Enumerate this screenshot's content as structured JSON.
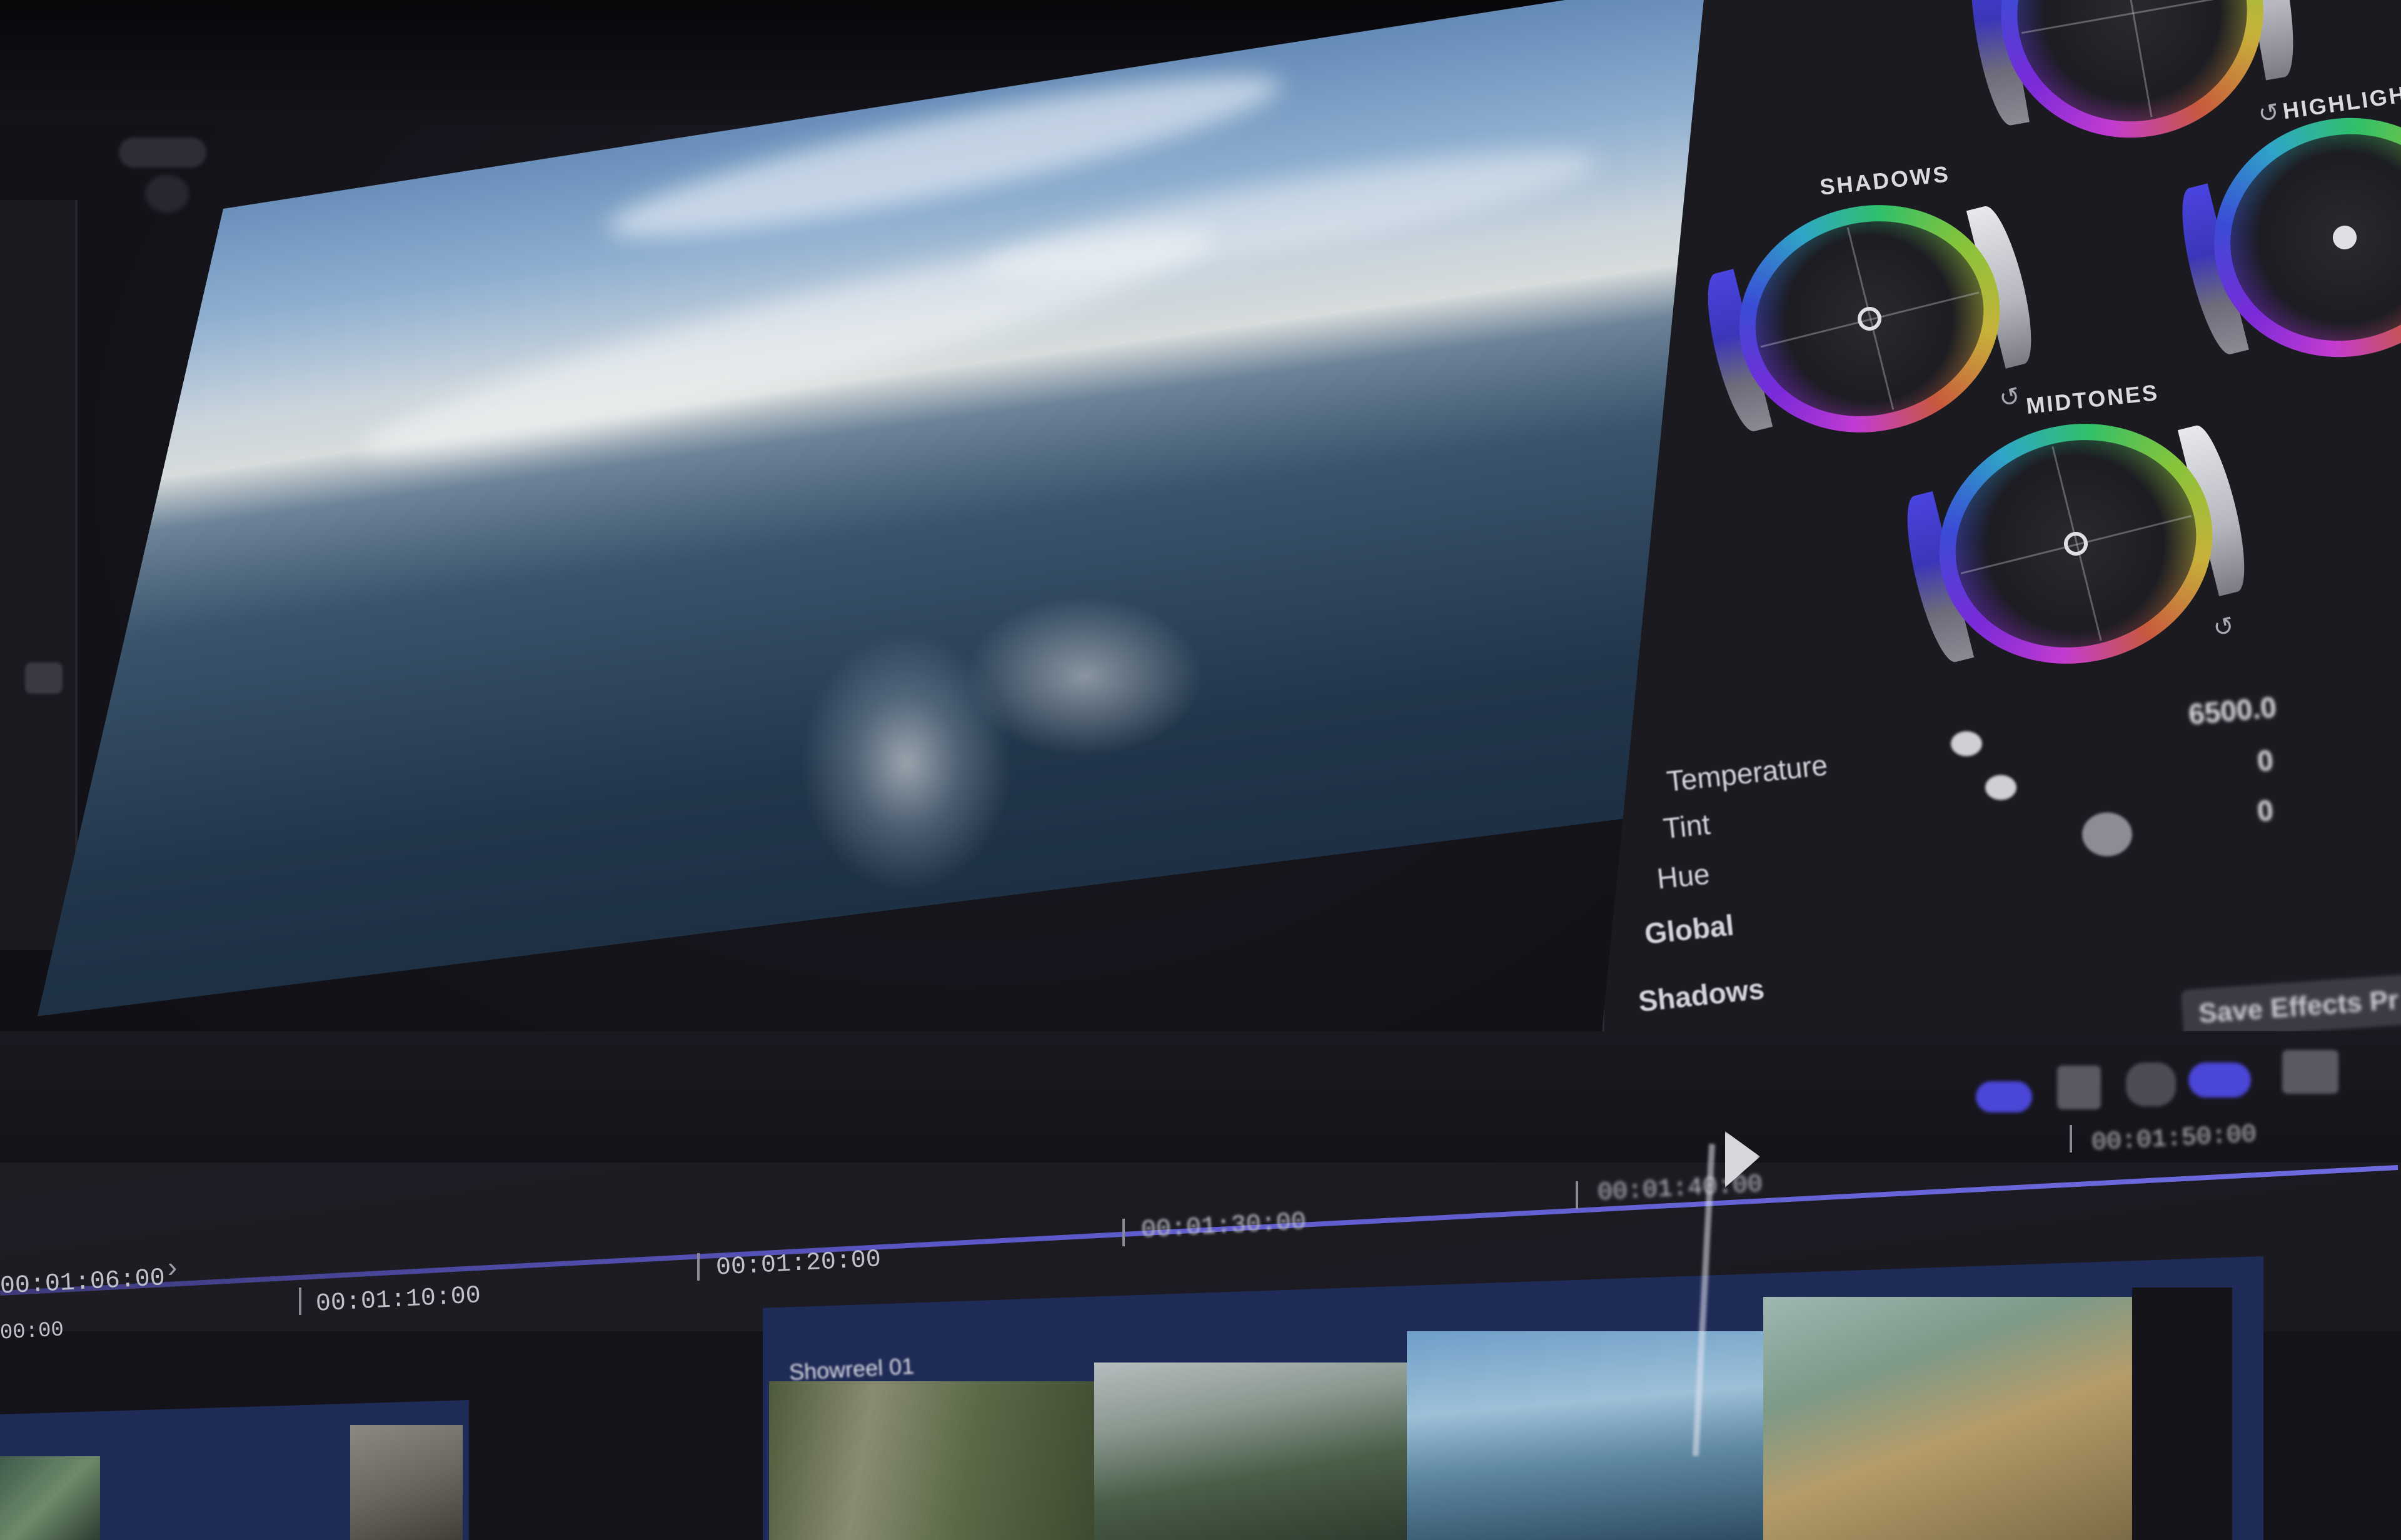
{
  "inspector": {
    "wheels": [
      {
        "label": "SHADOWS"
      },
      {
        "label": "MIDTONES"
      },
      {
        "label": "HIGHLIGHTS"
      }
    ],
    "temperature_label": "Temperature",
    "temperature_value": "6500.0",
    "tint_label": "Tint",
    "tint_value": "0",
    "hue_label": "Hue",
    "hue_value": "0",
    "global_label": "Global",
    "shadows_label": "Shadows",
    "save_button": "Save Effects Pr"
  },
  "timeline": {
    "timecodes": [
      "00:01:06:00",
      "00:01:10:00",
      "00:01:20:00",
      "00:01:30:00",
      "00:01:40:00",
      "00:01:50:00"
    ],
    "lower_left_tc": "00:00",
    "clip_name": "Showreel 01"
  },
  "colors": {
    "accent": "#5b58c8",
    "clip_track": "#1f2b57",
    "panel": "#1b1a21"
  },
  "icons": [
    "expand-icon",
    "chevron-right-icon",
    "reset-icon",
    "playhead-icon"
  ]
}
